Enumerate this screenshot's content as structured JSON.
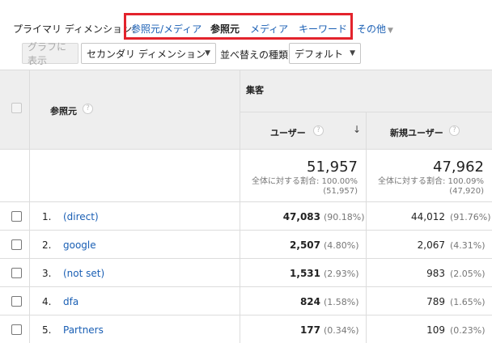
{
  "dimension_bar": {
    "label": "プライマリ ディメンション:",
    "links": [
      {
        "label": "参照元/メディア",
        "active": false
      },
      {
        "label": "参照元",
        "active": true
      },
      {
        "label": "メディア",
        "active": false
      },
      {
        "label": "キーワード",
        "active": false
      }
    ],
    "other": "その他"
  },
  "toolbar": {
    "graph_button": "グラフに表示",
    "secondary_dimension": "セカンダリ ディメンション",
    "sort_label": "並べ替えの種類:",
    "sort_value": "デフォルト"
  },
  "table": {
    "col_source": "参照元",
    "group_header": "集客",
    "col_users": "ユーザー",
    "col_new_users": "新規ユーザー",
    "summary": {
      "users_total": "51,957",
      "users_pct_line": "全体に対する割合: 100.00%",
      "users_pct_sub": "(51,957)",
      "new_total": "47,962",
      "new_pct_line": "全体に対する割合: 100.09%",
      "new_pct_sub": "(47,920)"
    },
    "rows": [
      {
        "num": "1.",
        "source": "(direct)",
        "users": "47,083",
        "users_pct": "(90.18%)",
        "new_users": "44,012",
        "new_pct": "(91.76%)"
      },
      {
        "num": "2.",
        "source": "google",
        "users": "2,507",
        "users_pct": "(4.80%)",
        "new_users": "2,067",
        "new_pct": "(4.31%)"
      },
      {
        "num": "3.",
        "source": "(not set)",
        "users": "1,531",
        "users_pct": "(2.93%)",
        "new_users": "983",
        "new_pct": "(2.05%)"
      },
      {
        "num": "4.",
        "source": "dfa",
        "users": "824",
        "users_pct": "(1.58%)",
        "new_users": "789",
        "new_pct": "(1.65%)"
      },
      {
        "num": "5.",
        "source": "Partners",
        "users": "177",
        "users_pct": "(0.34%)",
        "new_users": "109",
        "new_pct": "(0.23%)"
      }
    ]
  },
  "colors": {
    "highlight_box": "#e3232c",
    "link": "#1a5fb4",
    "header_bg": "#eeeeee"
  }
}
